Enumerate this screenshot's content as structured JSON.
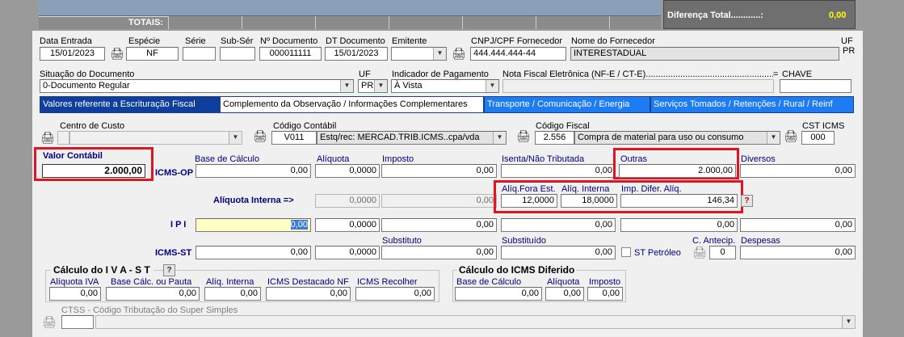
{
  "totals_bar": {
    "label": "TOTAIS:",
    "diff_label": "Diferença Total............:",
    "diff_value": "0,00"
  },
  "header": {
    "data_entrada_label": "Data Entrada",
    "data_entrada": "15/01/2023",
    "especie_label": "Espécie",
    "especie": "NF",
    "serie_label": "Série",
    "serie": "",
    "subserie_label": "Sub-Sér",
    "subserie": "",
    "num_doc_label": "Nº Documento",
    "num_doc": "000011111",
    "dt_doc_label": "DT Documento",
    "dt_doc": "15/01/2023",
    "emitente_label": "Emitente",
    "emitente": "",
    "cnpj_label": "CNPJ/CPF Fornecedor",
    "cnpj": "444.444.444-44",
    "nome_forn_label": "Nome do Fornecedor",
    "nome_forn": "INTERESTADUAL",
    "uf_label": "UF",
    "uf": "PR"
  },
  "row2": {
    "situacao_label": "Situação do Documento",
    "situacao": "0-Documento Regular",
    "uf_label": "UF",
    "uf": "PR",
    "pagamento_label": "Indicador de Pagamento",
    "pagamento": "À Vista",
    "nfe_label": "Nota Fiscal Eletrônica (NF-E / CT-E)....................................................................",
    "eq": "=",
    "chave_label": "CHAVE",
    "chave": ""
  },
  "tabs": [
    "Valores referente a Escrituração Fiscal",
    "Complemento da Observação / Informações Complementares",
    "Transporte / Comunicação / Energia",
    "Serviços Tomados / Retenções / Rural / Reinf"
  ],
  "codes": {
    "centro_custo_label": "Centro de Custo",
    "centro_custo": "",
    "codigo_contabil_label": "Código Contábil",
    "codigo_contabil": "V011",
    "codigo_contabil_desc": "Estq/rec: MERCAD.TRIB.ICMS..cpa/vda",
    "codigo_fiscal_label": "Código Fiscal",
    "codigo_fiscal": "2.556",
    "codigo_fiscal_desc": "Compra de material para uso ou consumo",
    "cst_label": "CST ICMS",
    "cst": "000"
  },
  "icms_op": {
    "valor_contabil_label": "Valor Contábil",
    "valor_contabil": "2.000,00",
    "row_label": "ICMS-OP",
    "base_label": "Base de Cálculo",
    "base": "0,00",
    "aliquota_label": "Alíquota",
    "aliquota": "0,0000",
    "imposto_label": "Imposto",
    "imposto": "0,00",
    "isenta_label": "Isenta/Não Tributada",
    "isenta": "0,00",
    "outras_label": "Outras",
    "outras": "2.000,00",
    "diversos_label": "Diversos",
    "diversos": "0,00"
  },
  "aliq_interna": {
    "label": "Alíquota Interna =>",
    "v1": "0,0000",
    "v2": "0,00",
    "fora_est_label": "Alíq.Fora Est.",
    "fora_est": "12,0000",
    "interna_label": "Alíq. Interna",
    "interna": "18,0000",
    "difer_label": "Imp. Difer. Alíq.",
    "difer": "146,34",
    "help": "?"
  },
  "ipi": {
    "label": "I P I",
    "v1": "0,00",
    "v2": "0,0000",
    "v3": "0,00",
    "v4": "0,00",
    "v5": "0,00",
    "v6": "0,00"
  },
  "icms_st": {
    "label": "ICMS-ST",
    "substituto_label": "Substituto",
    "substituido_label": "Substituído",
    "v1": "0,00",
    "v2": "0,0000",
    "v3": "0,00",
    "v4": "0,00",
    "st_petroleo": "ST Petróleo",
    "antecip_label": "C. Antecip.",
    "antecip": "0",
    "despesas_label": "Despesas",
    "despesas": "0,00"
  },
  "iva": {
    "title": "Cálculo  do  I V A - S T",
    "help": "?",
    "aliq_iva_label": "Alíquota IVA",
    "aliq_iva": "0,00",
    "base_pauta_label": "Base Cálc. ou Pauta",
    "base_pauta": "0,00",
    "aliq_interna_label": "Alíq. Interna",
    "aliq_interna": "0,00",
    "destacado_label": "ICMS Destacado NF",
    "destacado": "0,00",
    "recolher_label": "ICMS Recolher",
    "recolher": "0,00"
  },
  "diferido": {
    "title": "Cálculo do ICMS Diferido",
    "base_label": "Base de Cálculo",
    "base": "0,00",
    "aliquota_label": "Alíquota",
    "aliquota": "0,00",
    "imposto_label": "Imposto",
    "imposto": "0,00"
  },
  "ctss": {
    "label": "CTSS - Código Tributação do Super Simples",
    "code": "",
    "desc": ""
  },
  "colors": {
    "highlight_red": "#e0151f",
    "tab_active": "#0f3f9c",
    "tab_inactive": "#1e7cf2",
    "diff_value": "#ffff00"
  }
}
